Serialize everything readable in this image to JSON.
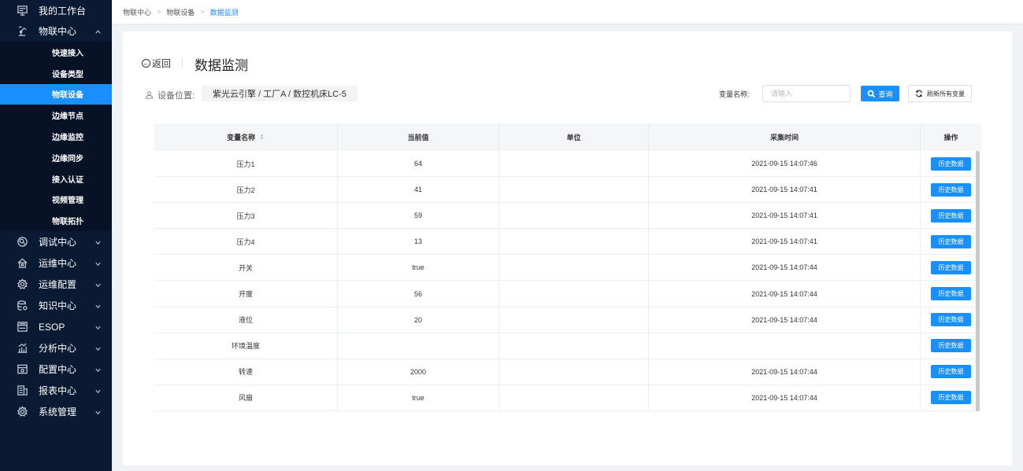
{
  "sidebar": {
    "workbench": {
      "label": "我的工作台",
      "icon": "monitor-icon"
    },
    "iot": {
      "label": "物联中心",
      "icon": "robot-arm-icon",
      "expanded": true,
      "items": [
        {
          "label": "快速接入",
          "active": false
        },
        {
          "label": "设备类型",
          "active": false
        },
        {
          "label": "物联设备",
          "active": true
        },
        {
          "label": "边缘节点",
          "active": false
        },
        {
          "label": "边缘监控",
          "active": false
        },
        {
          "label": "边缘同步",
          "active": false
        },
        {
          "label": "接入认证",
          "active": false
        },
        {
          "label": "视频管理",
          "active": false
        },
        {
          "label": "物联拓扑",
          "active": false
        }
      ]
    },
    "groups": [
      {
        "label": "调试中心",
        "icon": "debug-icon"
      },
      {
        "label": "运维中心",
        "icon": "home-icon"
      },
      {
        "label": "运维配置",
        "icon": "settings-icon"
      },
      {
        "label": "知识中心",
        "icon": "database-icon"
      },
      {
        "label": "ESOP",
        "icon": "esop-icon"
      },
      {
        "label": "分析中心",
        "icon": "analytics-icon"
      },
      {
        "label": "配置中心",
        "icon": "config-icon"
      },
      {
        "label": "报表中心",
        "icon": "report-icon"
      },
      {
        "label": "系统管理",
        "icon": "gear-icon"
      }
    ]
  },
  "breadcrumb": {
    "items": [
      "物联中心",
      "物联设备"
    ],
    "current": "数据监测"
  },
  "header": {
    "back_label": "返回",
    "title": "数据监测"
  },
  "device": {
    "label": "设备位置:",
    "value": "紫光云引擎 / 工厂A / 数控机床LC-5"
  },
  "search": {
    "label": "变量名称:",
    "placeholder": "请输入",
    "query_label": "查询",
    "refresh_label": "刷新所有变量"
  },
  "table": {
    "columns": [
      "变量名称",
      "当前值",
      "单位",
      "采集时间",
      "操作"
    ],
    "action_label": "历史数据",
    "rows": [
      {
        "name": "压力1",
        "value": "64",
        "unit": "",
        "time": "2021-09-15 14:07:46"
      },
      {
        "name": "压力2",
        "value": "41",
        "unit": "",
        "time": "2021-09-15 14:07:41"
      },
      {
        "name": "压力3",
        "value": "59",
        "unit": "",
        "time": "2021-09-15 14:07:41"
      },
      {
        "name": "压力4",
        "value": "13",
        "unit": "",
        "time": "2021-09-15 14:07:41"
      },
      {
        "name": "开关",
        "value": "true",
        "unit": "",
        "time": "2021-09-15 14:07:44"
      },
      {
        "name": "开度",
        "value": "56",
        "unit": "",
        "time": "2021-09-15 14:07:44"
      },
      {
        "name": "液位",
        "value": "20",
        "unit": "",
        "time": "2021-09-15 14:07:44"
      },
      {
        "name": "环境温度",
        "value": "",
        "unit": "",
        "time": ""
      },
      {
        "name": "转速",
        "value": "2000",
        "unit": "",
        "time": "2021-09-15 14:07:44"
      },
      {
        "name": "风扇",
        "value": "true",
        "unit": "",
        "time": "2021-09-15 14:07:44"
      }
    ]
  },
  "colors": {
    "accent": "#1890ff",
    "sidebar_bg": "#0a1a33"
  }
}
